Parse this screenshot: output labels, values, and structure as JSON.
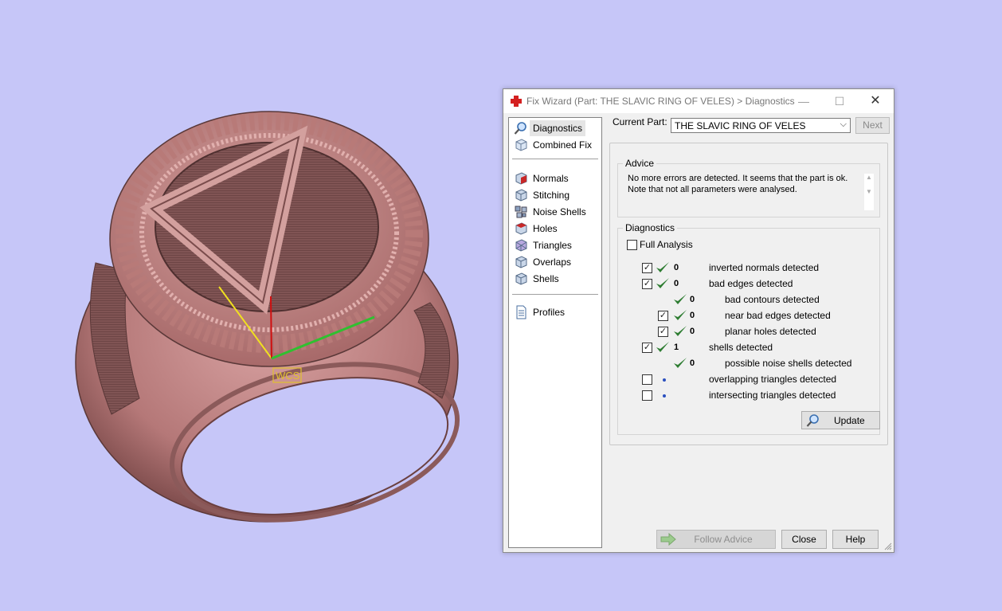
{
  "window": {
    "title": "Fix Wizard (Part: THE SLAVIC RING OF VELES) > Diagnostics",
    "minimize": "—",
    "maximize": "☐",
    "close": "✕"
  },
  "sidebar": {
    "items": [
      {
        "label": "Diagnostics",
        "icon": "magnifier-icon",
        "selected": true
      },
      {
        "label": "Combined Fix",
        "icon": "cube-outline-icon"
      },
      {
        "label": "Normals",
        "icon": "normals-cube-icon"
      },
      {
        "label": "Stitching",
        "icon": "stitching-cube-icon"
      },
      {
        "label": "Noise Shells",
        "icon": "noise-shells-icon"
      },
      {
        "label": "Holes",
        "icon": "holes-cube-icon"
      },
      {
        "label": "Triangles",
        "icon": "triangles-cube-icon"
      },
      {
        "label": "Overlaps",
        "icon": "overlaps-cube-icon"
      },
      {
        "label": "Shells",
        "icon": "shells-cube-icon"
      },
      {
        "label": "Profiles",
        "icon": "document-icon"
      }
    ]
  },
  "current_part": {
    "label": "Current Part:",
    "value": "THE SLAVIC RING OF VELES",
    "next": "Next"
  },
  "advice": {
    "label": "Advice",
    "line1": "No more errors are detected. It seems that the part is ok.",
    "line2": "Note that not all parameters were analysed."
  },
  "diagnostics": {
    "label": "Diagnostics",
    "full_analysis": "Full Analysis",
    "rows": [
      {
        "count": "0",
        "text": "inverted normals detected",
        "checkbox": true,
        "checked": true
      },
      {
        "count": "0",
        "text": "bad edges detected",
        "checkbox": true,
        "checked": true
      },
      {
        "count": "0",
        "text": "bad contours detected",
        "checkbox": false
      },
      {
        "count": "0",
        "text": "near bad edges detected",
        "checkbox": true,
        "checked": true
      },
      {
        "count": "0",
        "text": "planar holes detected",
        "checkbox": true,
        "checked": true
      },
      {
        "count": "1",
        "text": "shells detected",
        "checkbox": true,
        "checked": true
      },
      {
        "count": "0",
        "text": "possible noise shells detected",
        "checkbox": false
      },
      {
        "count": "",
        "text": "overlapping triangles detected",
        "checkbox": true,
        "checked": false
      },
      {
        "count": "",
        "text": "intersecting triangles detected",
        "checkbox": true,
        "checked": false
      }
    ],
    "update": "Update"
  },
  "buttons": {
    "follow_advice": "Follow Advice",
    "close": "Close",
    "help": "Help"
  },
  "viewport": {
    "wcs_label": "WCS"
  },
  "colors": {
    "background": "#c6c6f8",
    "ring": "#c98e8e",
    "check": "#2e7d32"
  }
}
